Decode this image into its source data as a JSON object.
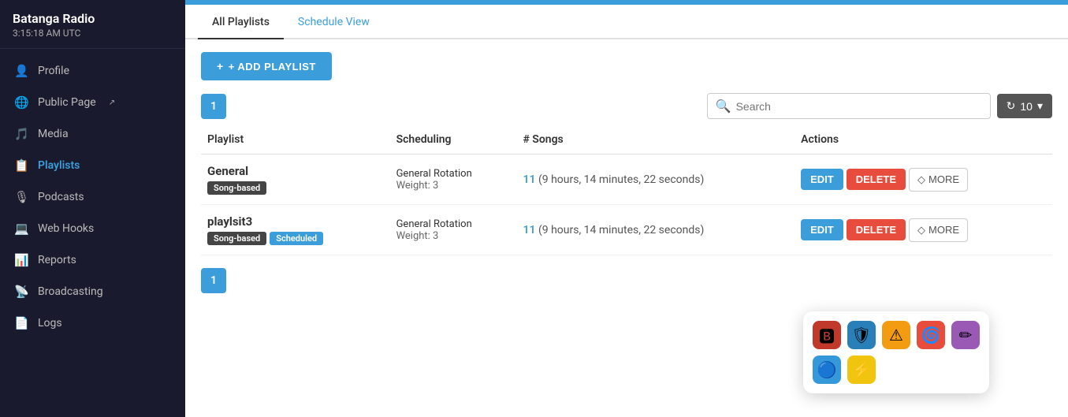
{
  "sidebar": {
    "station_name": "Batanga Radio",
    "station_time": "3:15:18 AM UTC",
    "nav_items": [
      {
        "id": "profile",
        "label": "Profile",
        "icon": "👤"
      },
      {
        "id": "public-page",
        "label": "Public Page",
        "icon": "🌐",
        "external": true
      },
      {
        "id": "media",
        "label": "Media",
        "icon": "🎵"
      },
      {
        "id": "playlists",
        "label": "Playlists",
        "icon": "📋",
        "active": true
      },
      {
        "id": "podcasts",
        "label": "Podcasts",
        "icon": "🎙"
      },
      {
        "id": "webhooks",
        "label": "Web Hooks",
        "icon": "💻"
      },
      {
        "id": "reports",
        "label": "Reports",
        "icon": "📊"
      },
      {
        "id": "broadcasting",
        "label": "Broadcasting",
        "icon": "📡"
      },
      {
        "id": "logs",
        "label": "Logs",
        "icon": "📄"
      }
    ]
  },
  "tabs": [
    {
      "id": "all-playlists",
      "label": "All Playlists",
      "active": true
    },
    {
      "id": "schedule-view",
      "label": "Schedule View",
      "active": false
    }
  ],
  "toolbar": {
    "add_button_label": "+ ADD PLAYLIST",
    "search_placeholder": "Search",
    "page_number": "1",
    "refresh_icon": "↻",
    "per_page": "10"
  },
  "table": {
    "columns": [
      "Playlist",
      "Scheduling",
      "# Songs",
      "Actions"
    ],
    "rows": [
      {
        "name": "General",
        "badges": [
          {
            "label": "Song-based",
            "type": "dark"
          }
        ],
        "scheduling": "General Rotation",
        "weight": "Weight: 3",
        "songs_count": "11",
        "songs_duration": "(9 hours, 14 minutes, 22 seconds)",
        "actions": {
          "edit": "EDIT",
          "delete": "DELETE",
          "more": "MORE"
        }
      },
      {
        "name": "playlsit3",
        "badges": [
          {
            "label": "Song-based",
            "type": "dark"
          },
          {
            "label": "Scheduled",
            "type": "blue"
          }
        ],
        "scheduling": "General Rotation",
        "weight": "Weight: 3",
        "songs_count": "11",
        "songs_duration": "(9 hours, 14 minutes, 22 seconds)",
        "actions": {
          "edit": "EDIT",
          "delete": "DELETE",
          "more": "MORE"
        }
      }
    ]
  },
  "bottom": {
    "page_number": "1"
  },
  "overlay_icons": [
    "🅱",
    "🛡",
    "⚠",
    "🌀",
    "✏",
    "🔵",
    "⚡"
  ]
}
